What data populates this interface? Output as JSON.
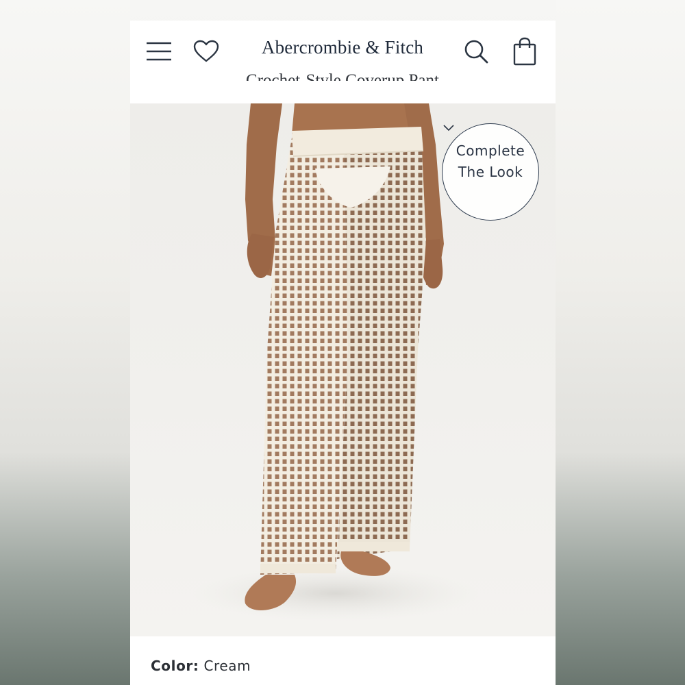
{
  "header": {
    "brand": "Abercrombie & Fitch",
    "partial_product_title": "Crochet-Style Coverup Pant",
    "icons": [
      "menu-icon",
      "heart-icon",
      "search-icon",
      "bag-icon"
    ]
  },
  "complete_the_look": {
    "line1": "Complete",
    "line2": "The Look",
    "icon": "chevron-down-icon"
  },
  "product": {
    "color_label": "Color:",
    "color_value": "Cream"
  },
  "colors": {
    "brand_navy": "#1f2a3a",
    "pant_cream": "#f3ede1",
    "skin": "#b07a57"
  }
}
